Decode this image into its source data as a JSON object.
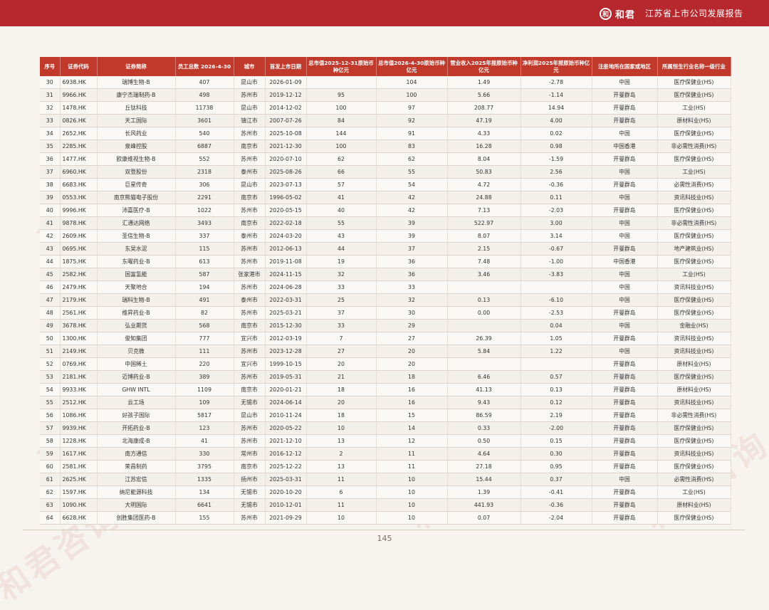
{
  "header": {
    "logo_mark": "和",
    "logo_text": "和君",
    "report_title": "江苏省上市公司发展报告"
  },
  "watermark_text": "和君咨询",
  "table": {
    "columns": [
      "序号",
      "证券代码",
      "证券简称",
      "员工总数 2026-4-30",
      "城市",
      "首发上市日期",
      "总市值2025-12-31原始币种亿元",
      "总市值2026-4-30原始币种亿元",
      "营业收入2025年报原始币种亿元",
      "净利润2025年报原始币种亿元",
      "注册地所在国家或地区",
      "所属恒生行业名称一级行业"
    ],
    "rows": [
      [
        "30",
        "6938.HK",
        "瑞博生物-B",
        "407",
        "昆山市",
        "2026-01-09",
        "",
        "104",
        "1.49",
        "-2.78",
        "中国",
        "医疗保健业(HS)"
      ],
      [
        "31",
        "9966.HK",
        "康宁杰瑞制药-B",
        "498",
        "苏州市",
        "2019-12-12",
        "95",
        "100",
        "5.66",
        "-1.14",
        "开曼群岛",
        "医疗保健业(HS)"
      ],
      [
        "32",
        "1478.HK",
        "丘钛科技",
        "11738",
        "昆山市",
        "2014-12-02",
        "100",
        "97",
        "208.77",
        "14.94",
        "开曼群岛",
        "工业(HS)"
      ],
      [
        "33",
        "0826.HK",
        "天工国际",
        "3601",
        "镇江市",
        "2007-07-26",
        "84",
        "92",
        "47.19",
        "4.00",
        "开曼群岛",
        "原材料业(HS)"
      ],
      [
        "34",
        "2652.HK",
        "长风药业",
        "540",
        "苏州市",
        "2025-10-08",
        "144",
        "91",
        "4.33",
        "0.02",
        "中国",
        "医疗保健业(HS)"
      ],
      [
        "35",
        "2285.HK",
        "泉峰控股",
        "6887",
        "南京市",
        "2021-12-30",
        "100",
        "83",
        "16.28",
        "0.98",
        "中国香港",
        "非必需性消费(HS)"
      ],
      [
        "36",
        "1477.HK",
        "欧康维视生物-B",
        "552",
        "苏州市",
        "2020-07-10",
        "62",
        "62",
        "8.04",
        "-1.59",
        "开曼群岛",
        "医疗保健业(HS)"
      ],
      [
        "37",
        "6960.HK",
        "双登股份",
        "2318",
        "泰州市",
        "2025-08-26",
        "66",
        "55",
        "50.83",
        "2.56",
        "中国",
        "工业(HS)"
      ],
      [
        "38",
        "6683.HK",
        "巨星传奇",
        "306",
        "昆山市",
        "2023-07-13",
        "57",
        "54",
        "4.72",
        "-0.36",
        "开曼群岛",
        "必需性消费(HS)"
      ],
      [
        "39",
        "0553.HK",
        "南京熊猫电子股份",
        "2291",
        "南京市",
        "1996-05-02",
        "41",
        "42",
        "24.88",
        "0.11",
        "中国",
        "资讯科技业(HS)"
      ],
      [
        "40",
        "9996.HK",
        "沛嘉医疗-B",
        "1022",
        "苏州市",
        "2020-05-15",
        "40",
        "42",
        "7.13",
        "-2.03",
        "开曼群岛",
        "医疗保健业(HS)"
      ],
      [
        "41",
        "9878.HK",
        "汇通达网络",
        "3493",
        "南京市",
        "2022-02-18",
        "55",
        "39",
        "522.97",
        "3.00",
        "中国",
        "非必需性消费(HS)"
      ],
      [
        "42",
        "2609.HK",
        "圣信生物-B",
        "337",
        "泰州市",
        "2024-03-20",
        "43",
        "39",
        "8.07",
        "3.14",
        "中国",
        "医疗保健业(HS)"
      ],
      [
        "43",
        "0695.HK",
        "东吴水泥",
        "115",
        "苏州市",
        "2012-06-13",
        "44",
        "37",
        "2.15",
        "-0.67",
        "开曼群岛",
        "地产建筑业(HS)"
      ],
      [
        "44",
        "1875.HK",
        "东曜药业-B",
        "613",
        "苏州市",
        "2019-11-08",
        "19",
        "36",
        "7.48",
        "-1.00",
        "中国香港",
        "医疗保健业(HS)"
      ],
      [
        "45",
        "2582.HK",
        "国富氢能",
        "587",
        "张家港市",
        "2024-11-15",
        "32",
        "36",
        "3.46",
        "-3.83",
        "中国",
        "工业(HS)"
      ],
      [
        "46",
        "2479.HK",
        "天聚地合",
        "194",
        "苏州市",
        "2024-06-28",
        "33",
        "33",
        "",
        "",
        "中国",
        "资讯科技业(HS)"
      ],
      [
        "47",
        "2179.HK",
        "瑞科生物-B",
        "491",
        "泰州市",
        "2022-03-31",
        "25",
        "32",
        "0.13",
        "-6.10",
        "中国",
        "医疗保健业(HS)"
      ],
      [
        "48",
        "2561.HK",
        "维昇药业-B",
        "82",
        "苏州市",
        "2025-03-21",
        "37",
        "30",
        "0.00",
        "-2.53",
        "开曼群岛",
        "医疗保健业(HS)"
      ],
      [
        "49",
        "3678.HK",
        "弘业期货",
        "568",
        "南京市",
        "2015-12-30",
        "33",
        "29",
        "",
        "0.04",
        "中国",
        "金融业(HS)"
      ],
      [
        "50",
        "1300.HK",
        "俊知集团",
        "777",
        "宜兴市",
        "2012-03-19",
        "7",
        "27",
        "26.39",
        "1.05",
        "开曼群岛",
        "资讯科技业(HS)"
      ],
      [
        "51",
        "2149.HK",
        "贝克微",
        "111",
        "苏州市",
        "2023-12-28",
        "27",
        "20",
        "5.84",
        "1.22",
        "中国",
        "资讯科技业(HS)"
      ],
      [
        "52",
        "0769.HK",
        "中国稀土",
        "220",
        "宜兴市",
        "1999-10-15",
        "20",
        "20",
        "",
        "",
        "开曼群岛",
        "原材料业(HS)"
      ],
      [
        "53",
        "2181.HK",
        "迈博药业-B",
        "389",
        "苏州市",
        "2019-05-31",
        "21",
        "18",
        "6.46",
        "0.57",
        "开曼群岛",
        "医疗保健业(HS)"
      ],
      [
        "54",
        "9933.HK",
        "GHW INTL",
        "1109",
        "南京市",
        "2020-01-21",
        "18",
        "16",
        "41.13",
        "0.13",
        "开曼群岛",
        "原材料业(HS)"
      ],
      [
        "55",
        "2512.HK",
        "云工场",
        "109",
        "无锡市",
        "2024-06-14",
        "20",
        "16",
        "9.43",
        "0.12",
        "开曼群岛",
        "资讯科技业(HS)"
      ],
      [
        "56",
        "1086.HK",
        "好孩子国际",
        "5817",
        "昆山市",
        "2010-11-24",
        "18",
        "15",
        "86.59",
        "2.19",
        "开曼群岛",
        "非必需性消费(HS)"
      ],
      [
        "57",
        "9939.HK",
        "开拓药业-B",
        "123",
        "苏州市",
        "2020-05-22",
        "10",
        "14",
        "0.33",
        "-2.00",
        "开曼群岛",
        "医疗保健业(HS)"
      ],
      [
        "58",
        "1228.HK",
        "北海康成-B",
        "41",
        "苏州市",
        "2021-12-10",
        "13",
        "12",
        "0.50",
        "0.15",
        "开曼群岛",
        "医疗保健业(HS)"
      ],
      [
        "59",
        "1617.HK",
        "南方通信",
        "330",
        "常州市",
        "2016-12-12",
        "2",
        "11",
        "4.64",
        "0.30",
        "开曼群岛",
        "资讯科技业(HS)"
      ],
      [
        "60",
        "2581.HK",
        "荣昌制药",
        "3795",
        "南京市",
        "2025-12-22",
        "13",
        "11",
        "27.18",
        "0.95",
        "开曼群岛",
        "医疗保健业(HS)"
      ],
      [
        "61",
        "2625.HK",
        "江苏宏信",
        "1335",
        "扬州市",
        "2025-03-31",
        "11",
        "10",
        "15.44",
        "0.37",
        "中国",
        "必需性消费(HS)"
      ],
      [
        "62",
        "1597.HK",
        "纳尼能源科技",
        "134",
        "无锡市",
        "2020-10-20",
        "6",
        "10",
        "1.39",
        "-0.41",
        "开曼群岛",
        "工业(HS)"
      ],
      [
        "63",
        "1090.HK",
        "大明国际",
        "6641",
        "无锡市",
        "2010-12-01",
        "11",
        "10",
        "441.93",
        "-0.36",
        "开曼群岛",
        "原材料业(HS)"
      ],
      [
        "64",
        "6628.HK",
        "创胜集团医药-B",
        "155",
        "苏州市",
        "2021-09-29",
        "10",
        "10",
        "0.07",
        "-2.04",
        "开曼群岛",
        "医疗保健业(HS)"
      ]
    ]
  },
  "page_number": "145"
}
